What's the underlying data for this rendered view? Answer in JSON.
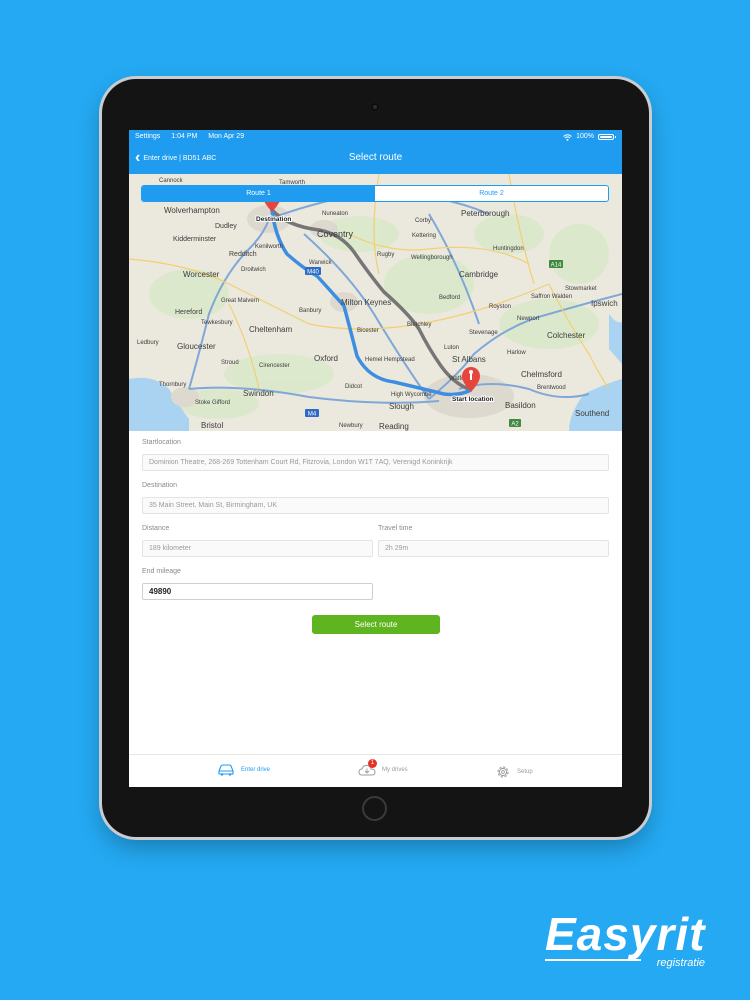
{
  "status_bar": {
    "carrier": "Settings",
    "time": "1:04 PM",
    "date": "Mon Apr 29",
    "battery": "100%"
  },
  "nav": {
    "back_label": "Enter drive | BD51 ABC",
    "title": "Select route"
  },
  "route_tabs": [
    {
      "label": "Route 1",
      "active": true
    },
    {
      "label": "Route 2",
      "active": false
    }
  ],
  "map": {
    "places": [
      "Wolverhampton",
      "Dudley",
      "Kidderminster",
      "Redditch",
      "Droitwich",
      "Worcester",
      "Great Malvern",
      "Hereford",
      "Tewkesbury",
      "Cheltenham",
      "Gloucester",
      "Ledbury",
      "Stroud",
      "Cirencester",
      "Swindon",
      "Bristol",
      "Thornbury",
      "Stoke Gifford",
      "Kenilworth",
      "Coventry",
      "Nuneaton",
      "Warwick",
      "Rugby",
      "Banbury",
      "Bicester",
      "Oxford",
      "Didcot",
      "Milton Keynes",
      "Bletchley",
      "Kettering",
      "Corby",
      "Wellingborough",
      "Bedford",
      "Peterborough",
      "Huntingdon",
      "Cambridge",
      "Stevenage",
      "Luton",
      "Hemel Hempstead",
      "St Albans",
      "Watford",
      "High Wycombe",
      "Slough",
      "Reading",
      "Newbury",
      "Chelmsford",
      "Brentwood",
      "Basildon",
      "Southend",
      "Colchester",
      "Ipswich",
      "Harlow",
      "Royston",
      "Saffron Walden",
      "Stowmarket",
      "Newport",
      "Cannock",
      "Tamworth"
    ],
    "road_labels": [
      "M40",
      "M4",
      "A14",
      "A2"
    ],
    "destination_label": "Destination",
    "start_label": "Start location",
    "colors": {
      "primary_route": "#4a90e2",
      "alt_route": "#7d7d7d",
      "pin": "#e5453b"
    }
  },
  "form": {
    "start": {
      "label": "Startlocation",
      "value": "Dominion Theatre, 268-269 Tottenham Court Rd, Fitzrovia, London W1T 7AQ, Verenigd Koninkrijk"
    },
    "destination": {
      "label": "Destination",
      "value": "35 Main Street, Main St, Birmingham, UK"
    },
    "distance": {
      "label": "Distance",
      "value": "189 kilometer"
    },
    "travel_time": {
      "label": "Travel time",
      "value": "2h 29m"
    },
    "end_mileage": {
      "label": "End mileage",
      "value": "49890"
    },
    "submit_label": "Select route"
  },
  "tabs": [
    {
      "label": "Enter drive",
      "icon": "car-icon",
      "active": true
    },
    {
      "label": "My drives",
      "icon": "cloud-icon",
      "badge": "1",
      "active": false
    },
    {
      "label": "Setup",
      "icon": "gear-icon",
      "active": false
    }
  ],
  "brand": {
    "name": "Easyrit",
    "tagline": "registratie"
  },
  "colors": {
    "background": "#24a9f2",
    "header": "#1f9cf0",
    "button": "#5fb51f",
    "badge": "#e5332a"
  }
}
